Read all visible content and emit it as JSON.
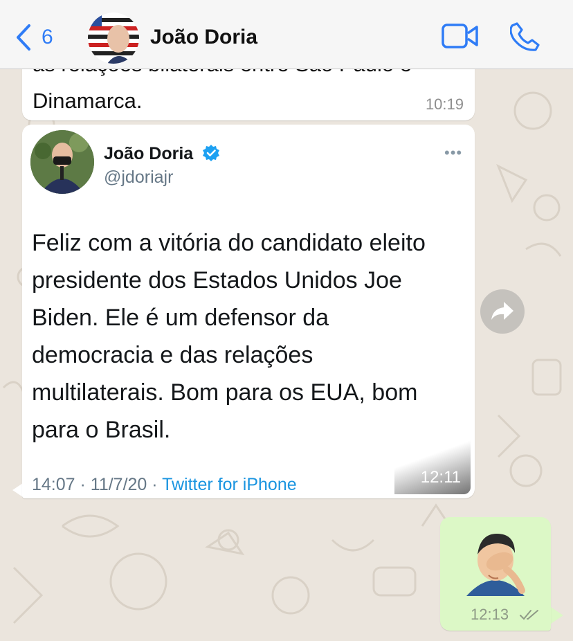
{
  "header": {
    "back_count": "6",
    "contact_name": "João Doria"
  },
  "messages": {
    "clipped_line": "as relações bilaterais entre São Paulo e",
    "clipped_text": "Dinamarca.",
    "clipped_time": "10:19",
    "tweet": {
      "name": "João Doria",
      "handle": "@jdoriajr",
      "more": "•••",
      "body_lines": [
        "Feliz com a vitória do candidato eleito",
        "presidente dos Estados Unidos Joe",
        "Biden. Ele é um defensor da",
        "democracia e das relações",
        "multilaterais. Bom para os EUA, bom",
        "para o Brasil."
      ],
      "meta_time": "14:07 · 11/7/20 ·",
      "meta_source": "Twitter for iPhone",
      "bubble_time": "12:11"
    },
    "outgoing_time": "12:13"
  },
  "colors": {
    "accent": "#2f7cf6",
    "outgoing_bubble": "#dcf8c6",
    "twitter_blue": "#1b95e0"
  },
  "icons": {
    "back": "chevron-left-icon",
    "video": "video-camera-icon",
    "call": "phone-icon",
    "verified": "verified-badge-icon",
    "forward": "forward-arrow-icon",
    "read_receipt": "double-check-icon",
    "emoji": "man-facepalming-emoji"
  }
}
